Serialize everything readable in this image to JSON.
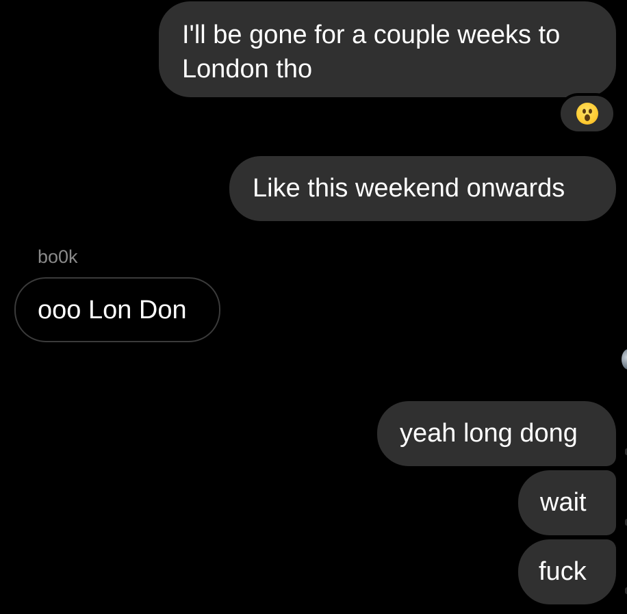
{
  "thread": {
    "messages": [
      {
        "sender": "me",
        "text": "I'll be gone for a couple weeks to London tho"
      },
      {
        "sender": "me",
        "text": "Like this weekend onwards"
      },
      {
        "sender": "bo0k",
        "text": "ooo Lon Don"
      },
      {
        "sender": "me",
        "text": "yeah long dong"
      },
      {
        "sender": "me",
        "text": "wait"
      },
      {
        "sender": "me",
        "text": "fuck"
      }
    ],
    "reaction": {
      "icon": "astonished-face-emoji",
      "target_message_index": 0
    },
    "other_sender_name": "bo0k"
  },
  "colors": {
    "background": "#000000",
    "outgoing_bubble": "#303030",
    "incoming_border": "#3b3b3b",
    "sender_name": "#8a8a8a",
    "text": "#ffffff"
  }
}
